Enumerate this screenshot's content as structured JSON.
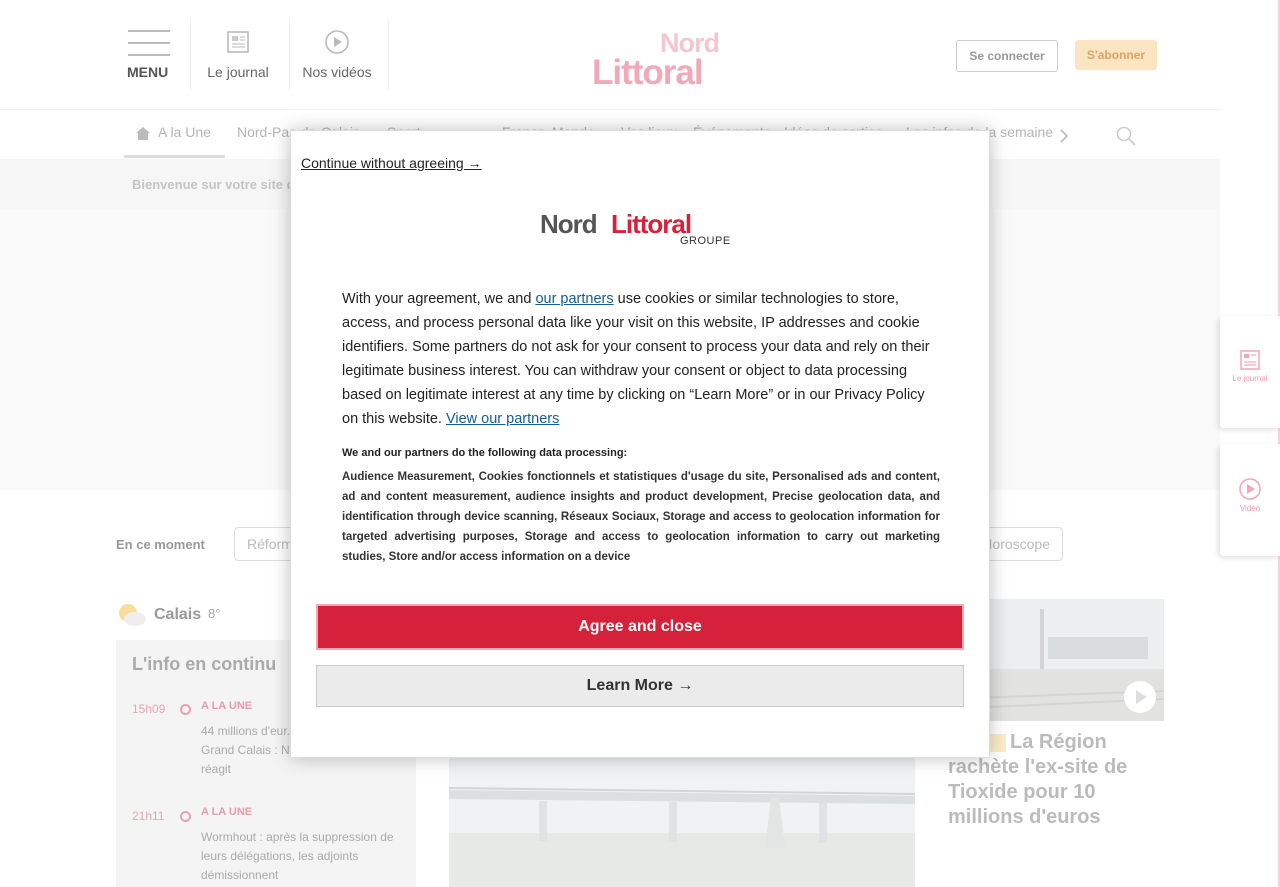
{
  "header": {
    "menu_label": "MENU",
    "journal_label": "Le journal",
    "videos_label": "Nos vidéos",
    "logo_top": "Nord",
    "logo_bottom": "Littoral",
    "connect_label": "Se connecter",
    "subscribe_label": "S'abonner"
  },
  "nav": {
    "items": [
      "A la Une",
      "Nord-Pas-de-Calais",
      "Sport",
      "France",
      "Monde",
      "Vos lieux",
      "Événements",
      "Idées de sorties",
      "Les infos de la semaine"
    ]
  },
  "welcome_text": "Bienvenue sur votre site d",
  "moment": {
    "label": "En ce moment",
    "chips": [
      "Réform",
      "Horoscope"
    ]
  },
  "weather": {
    "city": "Calais",
    "temp": "8°"
  },
  "live": {
    "title": "L'info en continu",
    "items": [
      {
        "time": "15h09",
        "category": "A LA UNE",
        "text": "44 millions d'eur... l'État et Emmanu... Grand Calais : Natacha Bouchart réagit"
      },
      {
        "time": "21h11",
        "category": "A LA UNE",
        "text": "Wormhout : après la suppression de leurs délégations, les adjoints démissionnent"
      }
    ]
  },
  "right_article": {
    "title": "La Région rachète l'ex-site de Tioxide pour 10 millions d'euros"
  },
  "side_tabs": {
    "journal": "Le journal",
    "video": "Vidéo"
  },
  "consent": {
    "continue_label": "Continue without agreeing →",
    "logo_a": "Nord",
    "logo_b": "Littoral",
    "logo_c": "GROUPE",
    "intro_1": "With your agreement, we and ",
    "partners_link": "our partners",
    "intro_2": " use cookies or similar technologies to store, access, and process personal data like your visit on this website, IP addresses and cookie identifiers. Some partners do not ask for your consent to process your data and rely on their legitimate business interest. You can withdraw your consent or object to data processing based on legitimate interest at any time by clicking on “Learn More” or in our Privacy Policy on this website. ",
    "view_partners_link": "View our partners",
    "processing_title": "We and our partners do the following data processing:",
    "processing_text": "Audience Measurement, Cookies fonctionnels et statistiques d'usage du site, Personalised ads and content, ad and content measurement, audience insights and product development, Precise geolocation data, and identification through device scanning, Réseaux Sociaux, Storage and access to geolocation information for targeted advertising purposes, Storage and access to geolocation information to carry out marketing studies, Store and/or access information on a device",
    "agree_label": "Agree and close",
    "learn_label": "Learn More →"
  }
}
